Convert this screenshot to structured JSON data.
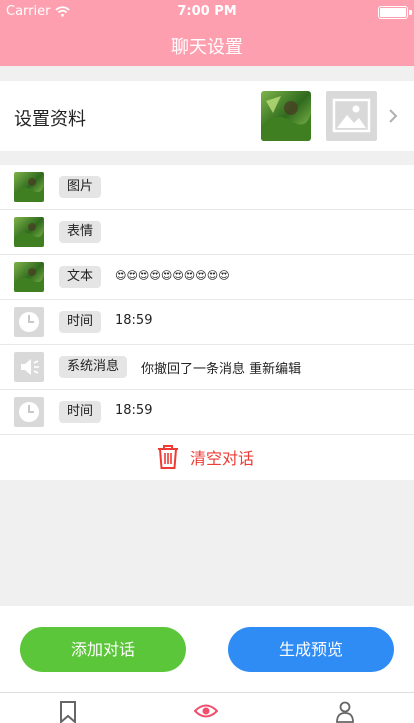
{
  "status": {
    "carrier": "Carrier",
    "time": "7:00 PM"
  },
  "header": {
    "title": "聊天设置"
  },
  "profile": {
    "label": "设置资料"
  },
  "messages": [
    {
      "tag": "图片",
      "content": "",
      "icon": "avatar"
    },
    {
      "tag": "表情",
      "content": "",
      "icon": "avatar"
    },
    {
      "tag": "文本",
      "content": "😍😍😍😍😍😍😍😍😍😍",
      "icon": "avatar"
    },
    {
      "tag": "时间",
      "content": "18:59",
      "icon": "clock-icon"
    },
    {
      "tag": "系统消息",
      "content": "你撤回了一条消息 重新编辑",
      "icon": "speaker-icon"
    },
    {
      "tag": "时间",
      "content": "18:59",
      "icon": "clock-icon"
    }
  ],
  "clear": {
    "label": "清空对话"
  },
  "actions": {
    "add_label": "添加对话",
    "preview_label": "生成预览"
  },
  "colors": {
    "header": "#fe9fb0",
    "add": "#5cc63a",
    "preview": "#2f8cf5",
    "danger": "#ee3b35",
    "active_tab": "#f0506e"
  },
  "tabbar": {
    "tabs": [
      "bookmark-icon",
      "eye-icon",
      "user-icon"
    ],
    "active": 1
  }
}
